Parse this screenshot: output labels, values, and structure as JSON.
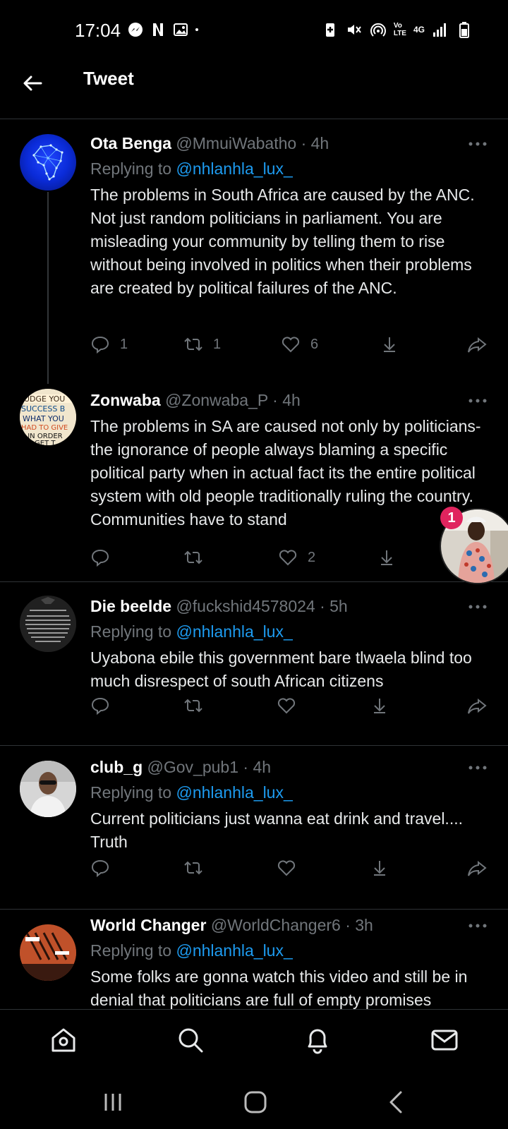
{
  "status_bar": {
    "time": "17:04",
    "left_icons": [
      "messenger-icon",
      "netflix-icon",
      "gallery-icon",
      "dot-icon"
    ],
    "right_icons": [
      "battery-saver-icon",
      "mute-icon",
      "hotspot-icon",
      "volte-icon",
      "4g-icon",
      "signal-icon",
      "battery-icon"
    ],
    "network_label_top": "Vo",
    "network_label_bottom": "LTE",
    "data_label": "4G"
  },
  "header": {
    "title": "Tweet",
    "back_icon": "arrow-left-icon"
  },
  "colors": {
    "background": "#000000",
    "text": "#e7e9ea",
    "muted": "#71767b",
    "link": "#1d9bf0",
    "badge": "#e0245e"
  },
  "tweets": [
    {
      "name": "Ota Benga",
      "handle": "@MmuiWabatho",
      "time": "· 4h",
      "replying_prefix": "Replying to ",
      "replying_to": "@nhlanhla_lux_",
      "text": "The problems  in South Africa are caused by the ANC. Not just random politicians in parliament. You are misleading your community by telling them to rise without being involved in politics when their problems are created by political failures  of the ANC.",
      "replies": "1",
      "retweets": "1",
      "likes": "6"
    },
    {
      "name": "Zonwaba",
      "handle": "@Zonwaba_P",
      "time": "· 4h",
      "replying_prefix": "",
      "replying_to": "",
      "text": "The problems in SA are caused not only by politicians-the ignorance of people always blaming a specific political party when in actual fact its the entire political system with old people traditionally ruling the country. Communities have to stand",
      "replies": "",
      "retweets": "",
      "likes": "2"
    },
    {
      "name": "Die beelde",
      "handle": "@fuckshid4578024",
      "time": "· 5h",
      "replying_prefix": "Replying to ",
      "replying_to": "@nhlanhla_lux_",
      "text": "Uyabona ebile this government bare tlwaela blind too much disrespect of south African citizens",
      "replies": "",
      "retweets": "",
      "likes": ""
    },
    {
      "name": "club_g",
      "handle": "@Gov_pub1",
      "time": "· 4h",
      "replying_prefix": "Replying to ",
      "replying_to": "@nhlanhla_lux_",
      "text": "Current politicians just wanna eat drink and travel.... Truth",
      "replies": "",
      "retweets": "",
      "likes": ""
    },
    {
      "name": "World Changer",
      "handle": "@WorldChanger6",
      "time": "· 3h",
      "replying_prefix": "Replying to ",
      "replying_to": "@nhlanhla_lux_",
      "text": "Some folks are gonna watch this video and still be in denial that politicians are full of empty promises",
      "replies": "",
      "retweets": "",
      "likes": ""
    }
  ],
  "floating_bubble": {
    "badge_count": "1"
  },
  "bottom_nav": [
    "home-icon",
    "search-icon",
    "notifications-icon",
    "messages-icon"
  ],
  "system_nav": [
    "recents-icon",
    "home-button-icon",
    "back-button-icon"
  ]
}
